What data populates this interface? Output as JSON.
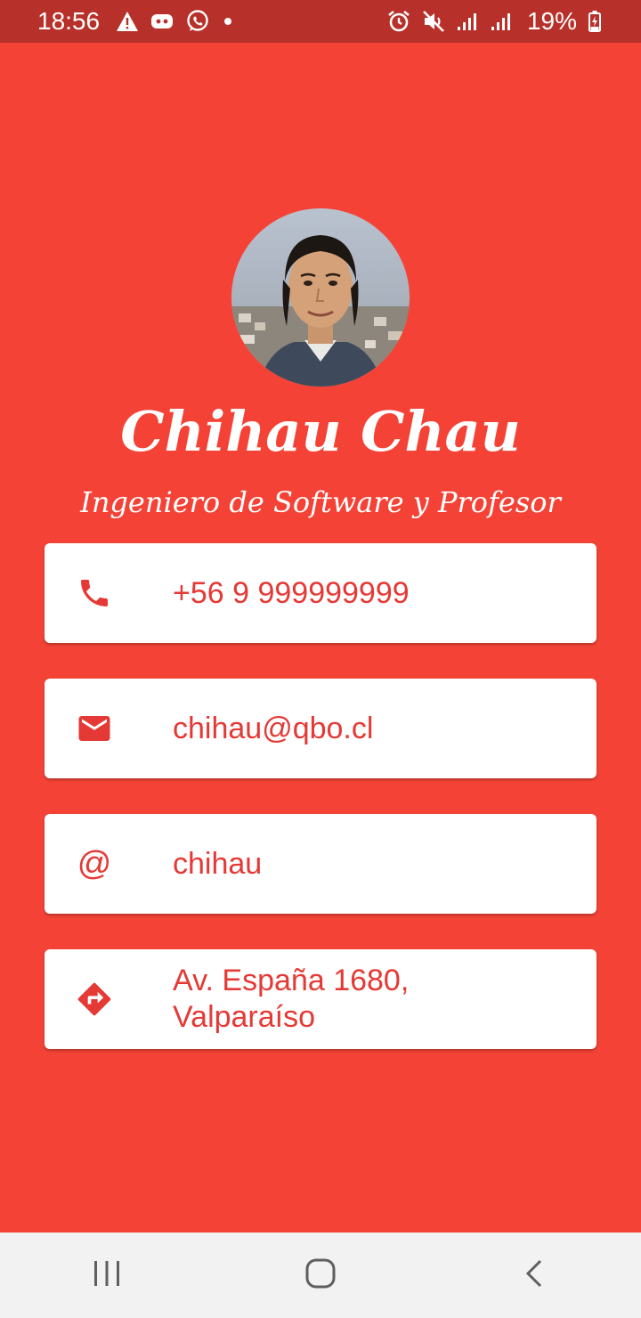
{
  "status_bar": {
    "time": "18:56",
    "battery": "19%",
    "left_icons": [
      "warning-icon",
      "discord-icon",
      "whatsapp-icon",
      "dot-icon"
    ],
    "right_icons": [
      "alarm-icon",
      "mute-icon",
      "signal-icon",
      "signal-icon",
      "battery-charging-icon"
    ]
  },
  "profile": {
    "name": "Chihau Chau",
    "title": "Ingeniero de Software y Profesor"
  },
  "contacts": [
    {
      "icon": "phone-icon",
      "label": "+56 9 999999999"
    },
    {
      "icon": "email-icon",
      "label": "chihau@qbo.cl"
    },
    {
      "icon": "at-icon",
      "symbol": "@",
      "label": "chihau"
    },
    {
      "icon": "directions-icon",
      "label_line1": "Av. España 1680,",
      "label_line2": "Valparaíso"
    }
  ],
  "nav_bar": {
    "buttons": [
      "recent-apps-icon",
      "home-icon",
      "back-icon"
    ]
  },
  "colors": {
    "background": "#f44336",
    "status_bar": "#b8302a",
    "accent": "#e53935",
    "card": "#ffffff",
    "nav_bar": "#f2f2f2"
  }
}
